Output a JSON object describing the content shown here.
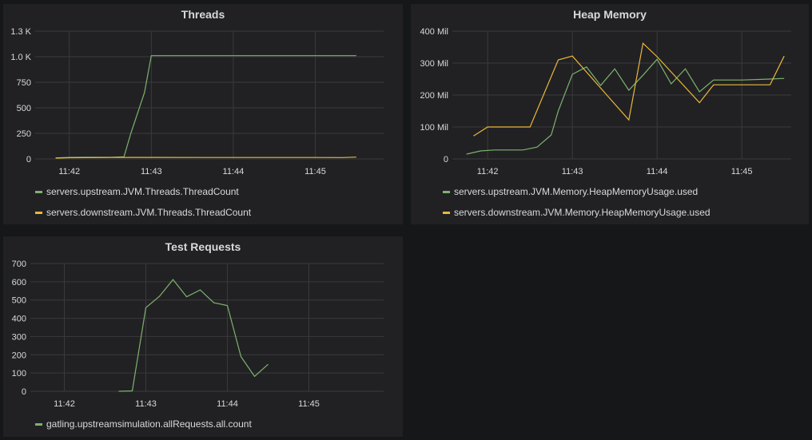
{
  "chart_data": [
    {
      "type": "line",
      "title": "Threads",
      "xlabel": "",
      "ylabel": "",
      "ylim": [
        0,
        1250
      ],
      "y_ticks": [
        0,
        250,
        500,
        750,
        1000,
        1250
      ],
      "y_tick_labels": [
        "0",
        "250",
        "500",
        "750",
        "1.0 K",
        "1.3 K"
      ],
      "xlim": [
        "11:41:35",
        "11:45:50"
      ],
      "x_ticks": [
        "11:42",
        "11:43",
        "11:44",
        "11:45"
      ],
      "x_tick_labels": [
        "11:42",
        "11:43",
        "11:44",
        "11:45"
      ],
      "grid": true,
      "legend": "bottom",
      "series": [
        {
          "name": "servers.upstream.JVM.Threads.ThreadCount",
          "color": "#7eb26d",
          "x": [
            "11:41:50",
            "11:42:00",
            "11:42:10",
            "11:42:20",
            "11:42:30",
            "11:42:40",
            "11:42:45",
            "11:42:55",
            "11:43:00",
            "11:43:30",
            "11:44:00",
            "11:44:30",
            "11:45:00",
            "11:45:30"
          ],
          "y": [
            10,
            15,
            16,
            16,
            16,
            20,
            250,
            650,
            1010,
            1010,
            1010,
            1010,
            1010,
            1010
          ]
        },
        {
          "name": "servers.downstream.JVM.Threads.ThreadCount",
          "color": "#eab839",
          "x": [
            "11:41:50",
            "11:42:00",
            "11:42:30",
            "11:42:45",
            "11:43:00",
            "11:44:00",
            "11:45:00",
            "11:45:20",
            "11:45:30"
          ],
          "y": [
            8,
            12,
            14,
            15,
            15,
            14,
            14,
            13,
            18
          ]
        }
      ]
    },
    {
      "type": "line",
      "title": "Heap Memory",
      "xlabel": "",
      "ylabel": "",
      "ylim": [
        0,
        400
      ],
      "y_ticks": [
        0,
        100,
        200,
        300,
        400
      ],
      "y_tick_labels": [
        "0",
        "100 Mil",
        "200 Mil",
        "300 Mil",
        "400 Mil"
      ],
      "xlim": [
        "11:41:35",
        "11:45:35"
      ],
      "x_ticks": [
        "11:42",
        "11:43",
        "11:44",
        "11:45"
      ],
      "x_tick_labels": [
        "11:42",
        "11:43",
        "11:44",
        "11:45"
      ],
      "grid": true,
      "legend": "bottom",
      "series": [
        {
          "name": "servers.upstream.JVM.Memory.HeapMemoryUsage.used",
          "color": "#7eb26d",
          "x": [
            "11:41:45",
            "11:41:55",
            "11:42:05",
            "11:42:15",
            "11:42:25",
            "11:42:35",
            "11:42:45",
            "11:42:50",
            "11:43:00",
            "11:43:10",
            "11:43:20",
            "11:43:30",
            "11:43:40",
            "11:43:50",
            "11:44:00",
            "11:44:10",
            "11:44:20",
            "11:44:30",
            "11:44:40",
            "11:45:00",
            "11:45:20",
            "11:45:30"
          ],
          "y": [
            15,
            25,
            28,
            28,
            28,
            37,
            75,
            150,
            265,
            288,
            230,
            282,
            215,
            262,
            312,
            235,
            282,
            210,
            247,
            247,
            250,
            252
          ]
        },
        {
          "name": "servers.downstream.JVM.Memory.HeapMemoryUsage.used",
          "color": "#eab839",
          "x": [
            "11:41:50",
            "11:42:00",
            "11:42:30",
            "11:42:50",
            "11:43:00",
            "11:43:40",
            "11:43:50",
            "11:44:00",
            "11:44:30",
            "11:44:40",
            "11:45:00",
            "11:45:20",
            "11:45:30"
          ],
          "y": [
            72,
            100,
            100,
            310,
            322,
            122,
            362,
            320,
            176,
            232,
            232,
            232,
            322
          ]
        }
      ]
    },
    {
      "type": "line",
      "title": "Test Requests",
      "xlabel": "",
      "ylabel": "",
      "ylim": [
        0,
        700
      ],
      "y_ticks": [
        0,
        100,
        200,
        300,
        400,
        500,
        600,
        700
      ],
      "y_tick_labels": [
        "0",
        "100",
        "200",
        "300",
        "400",
        "500",
        "600",
        "700"
      ],
      "xlim": [
        "11:41:35",
        "11:45:55"
      ],
      "x_ticks": [
        "11:42",
        "11:43",
        "11:44",
        "11:45"
      ],
      "x_tick_labels": [
        "11:42",
        "11:43",
        "11:44",
        "11:45"
      ],
      "grid": true,
      "legend": "bottom",
      "series": [
        {
          "name": "gatling.upstreamsimulation.allRequests.all.count",
          "color": "#7eb26d",
          "x": [
            "11:42:40",
            "11:42:50",
            "11:43:00",
            "11:43:10",
            "11:43:20",
            "11:43:30",
            "11:43:40",
            "11:43:50",
            "11:44:00",
            "11:44:10",
            "11:44:20",
            "11:44:30"
          ],
          "y": [
            0,
            2,
            458,
            520,
            612,
            518,
            555,
            485,
            470,
            190,
            82,
            148
          ]
        }
      ]
    }
  ]
}
